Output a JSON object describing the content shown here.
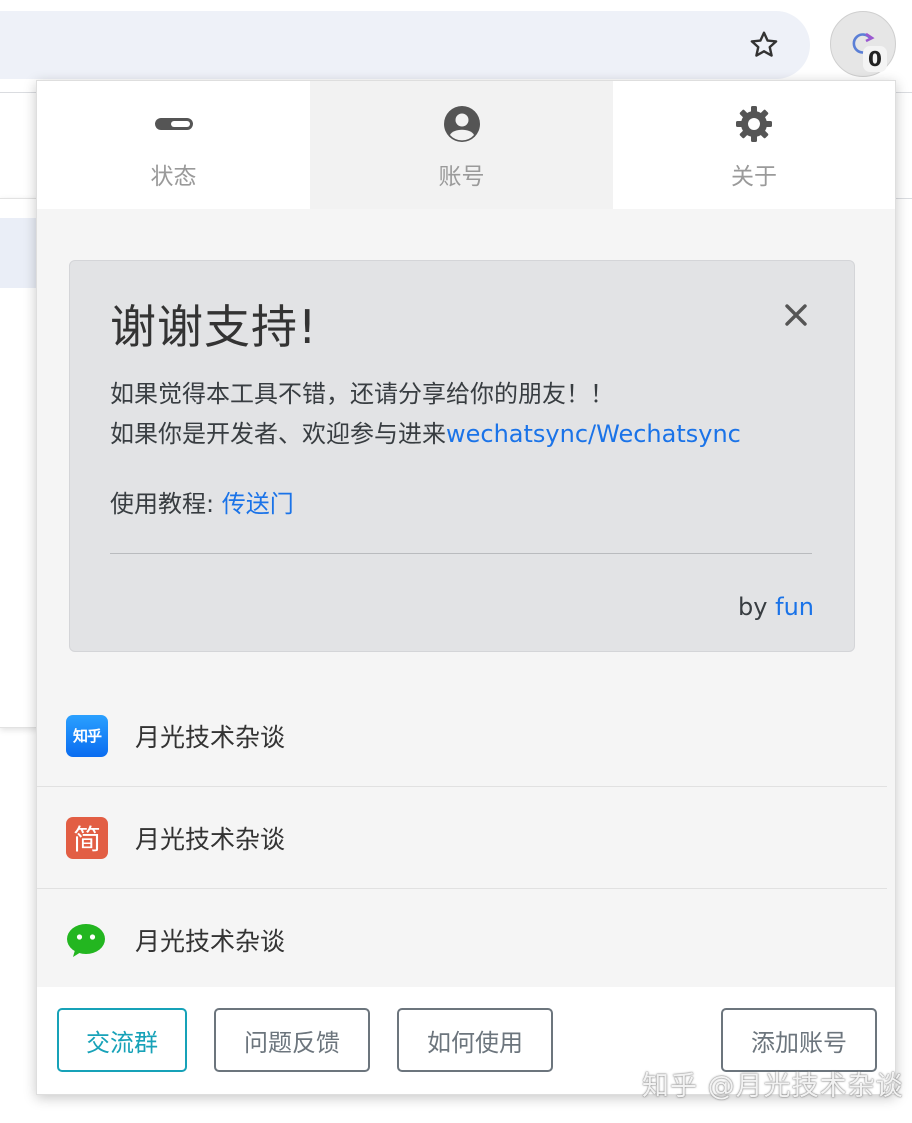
{
  "browser": {
    "extension_badge": "0"
  },
  "tabs": [
    {
      "label": "状态",
      "icon": "toggle-icon"
    },
    {
      "label": "账号",
      "icon": "user-circle-icon"
    },
    {
      "label": "关于",
      "icon": "gear-icon"
    }
  ],
  "notice": {
    "title": "谢谢支持!",
    "line1": "如果觉得本工具不错，还请分享给你的朋友！！",
    "line2_prefix": "如果你是开发者、欢迎参与进来",
    "line2_link": "wechatsync/Wechatsync",
    "tutorial_prefix": "使用教程: ",
    "tutorial_link": "传送门",
    "by_prefix": "by ",
    "by_link": "fun"
  },
  "accounts": [
    {
      "platform_icon": "知乎",
      "name": "月光技术杂谈",
      "color": "#0a84ff"
    },
    {
      "platform_icon": "简",
      "name": "月光技术杂谈",
      "color": "#e25e44"
    },
    {
      "platform_icon": "wechat-icon",
      "name": "月光技术杂谈",
      "color": "#23b620"
    }
  ],
  "footer": {
    "group_button": "交流群",
    "feedback_button": "问题反馈",
    "howto_button": "如何使用",
    "add_account_button": "添加账号"
  },
  "watermark": "知乎 @月光技术杂谈",
  "colors": {
    "link": "#1a73e8",
    "primary_outline": "#17a2b8",
    "secondary_outline": "#6c757d",
    "notice_bg": "#e2e3e5"
  }
}
